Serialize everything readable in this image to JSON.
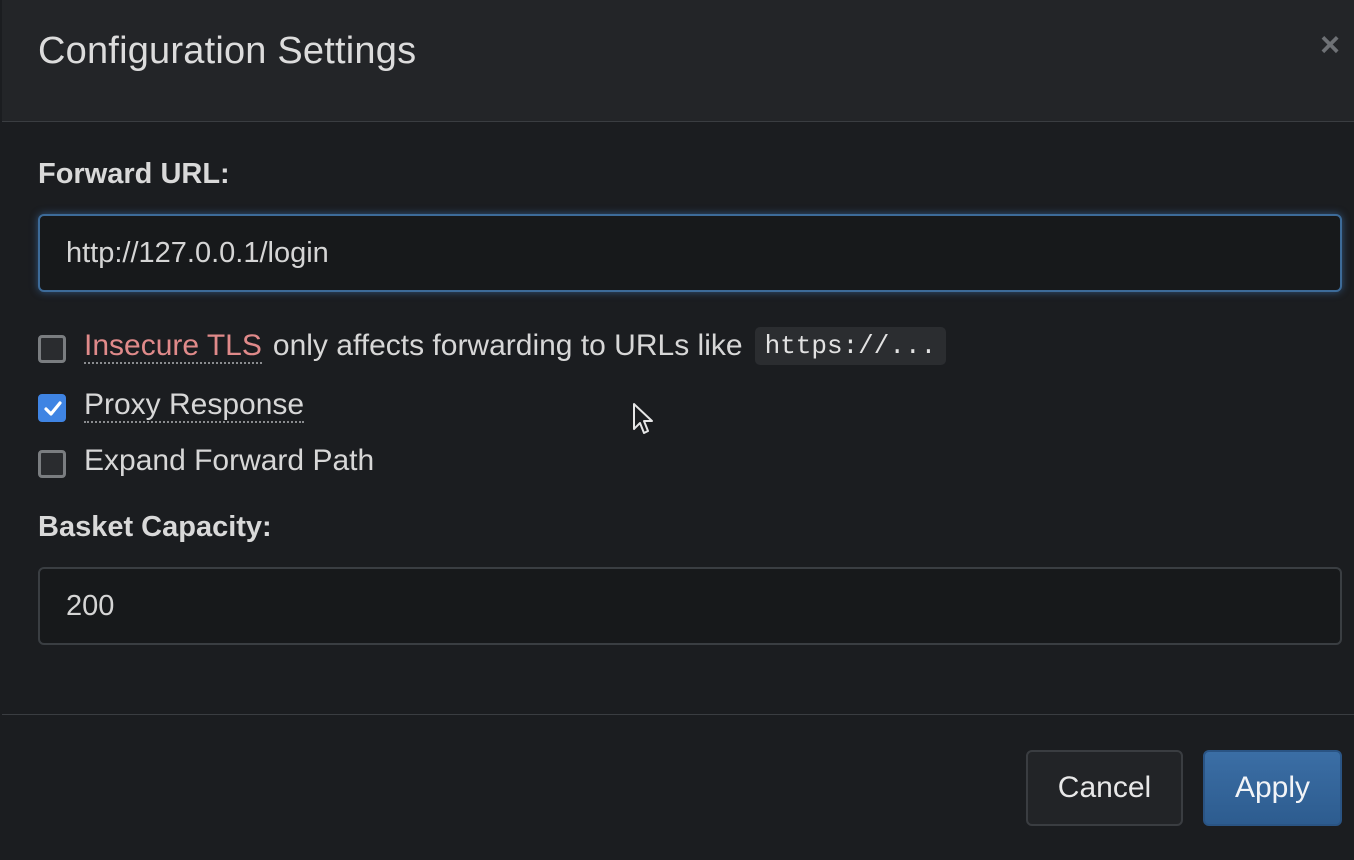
{
  "dialog": {
    "title": "Configuration Settings",
    "close_label": "×"
  },
  "forward_url": {
    "label": "Forward URL:",
    "value": "http://127.0.0.1/login"
  },
  "options": {
    "insecure_tls": {
      "checked": false,
      "label": "Insecure TLS",
      "description": "only affects forwarding to URLs like",
      "code": "https://..."
    },
    "proxy_response": {
      "checked": true,
      "label": "Proxy Response"
    },
    "expand_forward_path": {
      "checked": false,
      "label": "Expand Forward Path"
    }
  },
  "basket_capacity": {
    "label": "Basket Capacity:",
    "value": "200"
  },
  "buttons": {
    "cancel": "Cancel",
    "apply": "Apply"
  },
  "colors": {
    "accent": "#3f84e3",
    "danger_text": "#e08a8a",
    "apply_button": "#336699"
  }
}
